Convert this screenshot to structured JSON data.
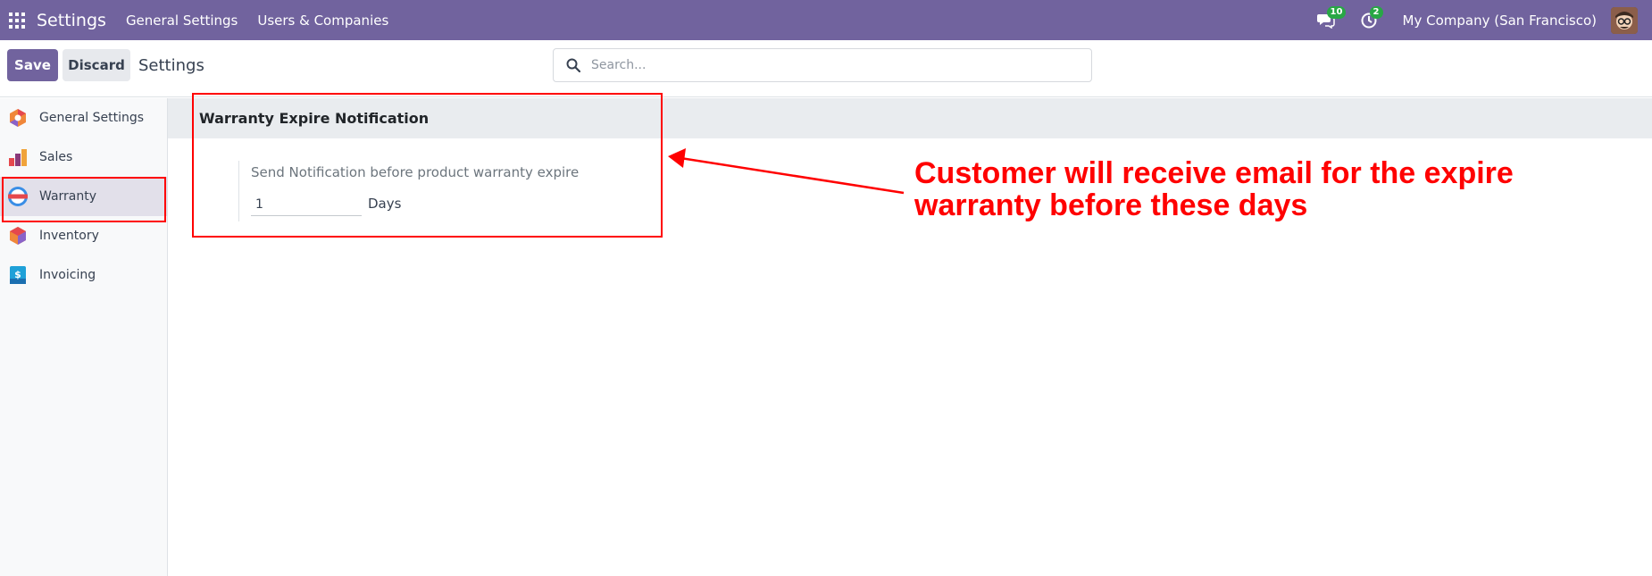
{
  "navbar": {
    "app_title": "Settings",
    "menu": [
      "General Settings",
      "Users & Companies"
    ],
    "messages_count": "10",
    "activities_count": "2",
    "company": "My Company (San Francisco)"
  },
  "control_panel": {
    "save_label": "Save",
    "discard_label": "Discard",
    "title": "Settings",
    "search_placeholder": "Search..."
  },
  "sidebar": {
    "items": [
      {
        "label": "General Settings",
        "icon": "general-settings-icon"
      },
      {
        "label": "Sales",
        "icon": "sales-icon"
      },
      {
        "label": "Warranty",
        "icon": "warranty-icon",
        "active": true
      },
      {
        "label": "Inventory",
        "icon": "inventory-icon"
      },
      {
        "label": "Invoicing",
        "icon": "invoicing-icon"
      }
    ]
  },
  "main": {
    "section_title": "Warranty Expire Notification",
    "setting_label": "Send Notification before product warranty expire",
    "days_value": "1",
    "days_unit": "Days"
  },
  "annotation": {
    "line1": "Customer will receive email for the expire",
    "line2": "warranty before these days",
    "color": "#ff0000"
  },
  "colors": {
    "navbar": "#71639e",
    "primary_button": "#71639e",
    "badge": "#28a745"
  }
}
